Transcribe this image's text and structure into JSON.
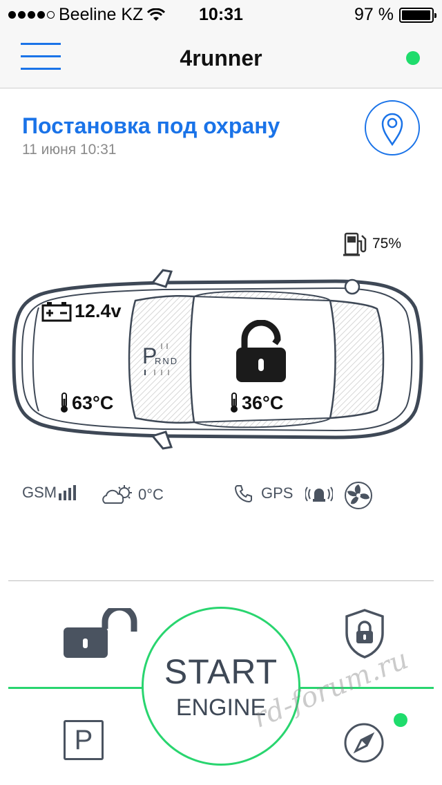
{
  "status_bar": {
    "carrier": "Beeline KZ",
    "time": "10:31",
    "battery": "97 %",
    "battery_level": 0.97,
    "signal_bars_filled": 4,
    "signal_bars_total": 5
  },
  "nav": {
    "title": "4runner",
    "menu_icon": "hamburger-menu-icon",
    "status_color": "#1fdc6c"
  },
  "event": {
    "title": "Постановка под охрану",
    "date": "11 июня 10:31",
    "locate_icon": "map-pin-icon"
  },
  "car": {
    "fuel": "75%",
    "battery_voltage": "12.4v",
    "engine_temp": "63°C",
    "cabin_temp": "36°C",
    "gear_indicator": "P",
    "gear_other": "RND",
    "lock_state": "unlocked"
  },
  "indicators": {
    "gsm": "GSM",
    "outside_temp": "0°C",
    "gps": "GPS",
    "icons": [
      "signal-bars-icon",
      "cloud-sun-icon",
      "phone-icon",
      "siren-icon",
      "fan-icon"
    ]
  },
  "controls": {
    "start_line1": "START",
    "start_line2": "ENGINE",
    "unlock_icon": "open-padlock-icon",
    "arm_icon": "shield-lock-icon",
    "parking_label": "P",
    "navigate_icon": "compass-icon"
  },
  "watermark": "rd-forum.ru",
  "colors": {
    "accent": "#1a73e8",
    "green": "#29d56f",
    "dark_icon": "#3e4856"
  }
}
